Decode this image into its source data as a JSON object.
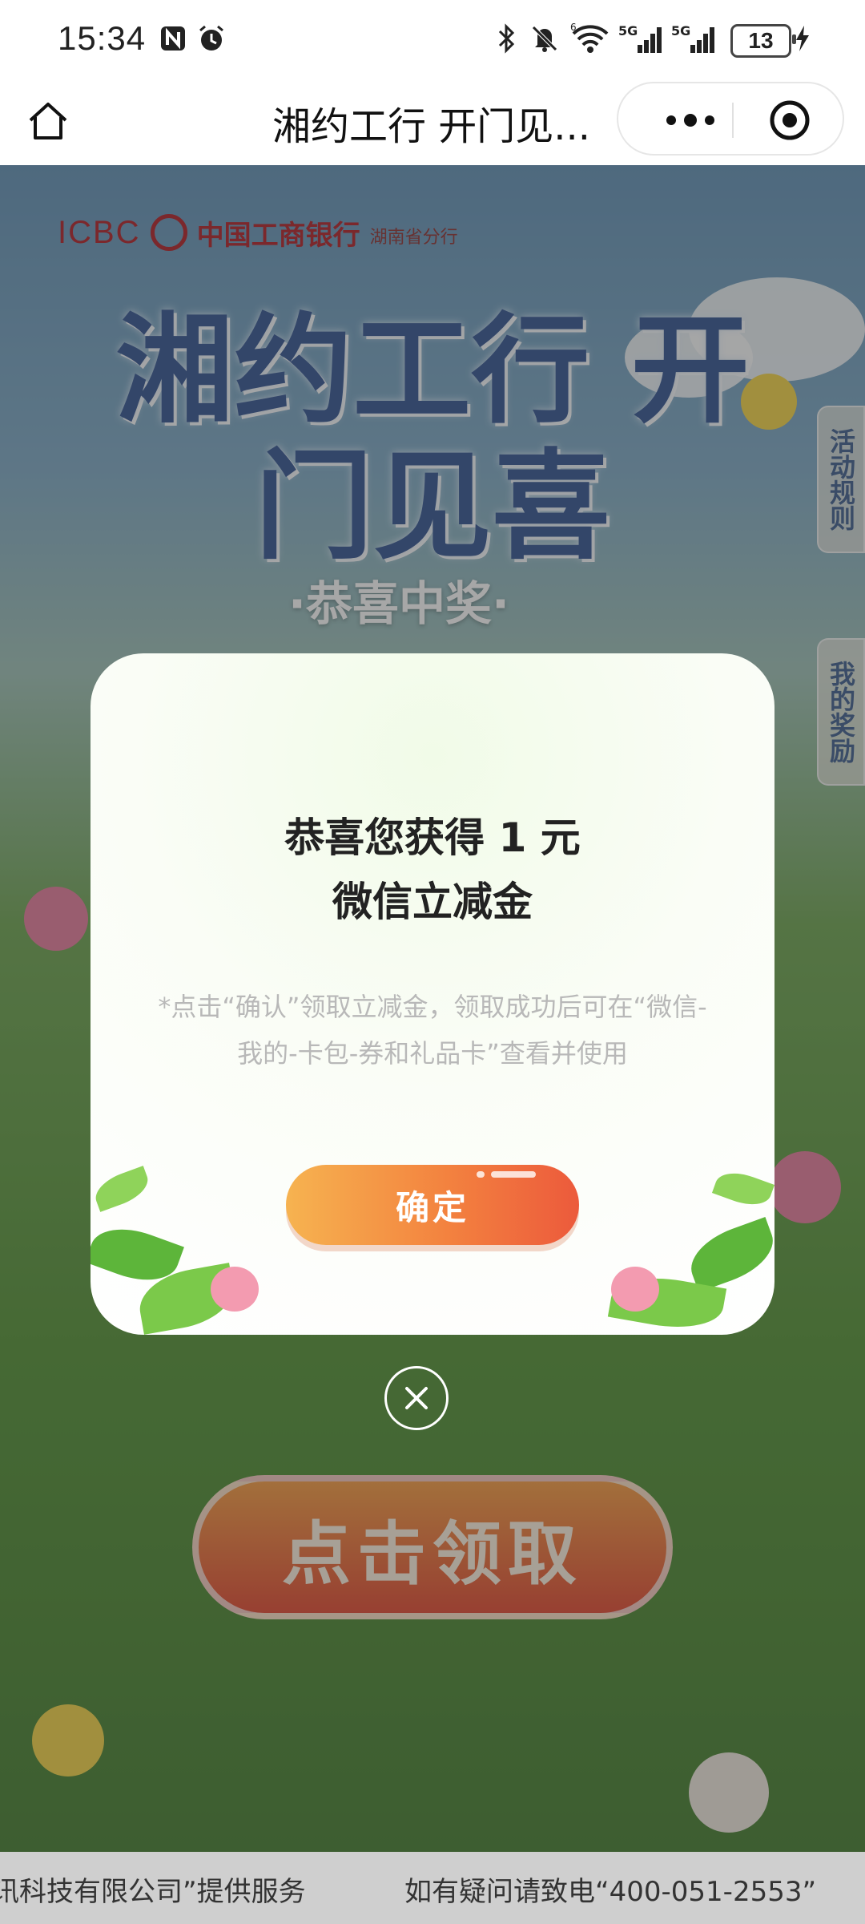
{
  "status_bar": {
    "time": "15:34",
    "battery": "13",
    "icons": [
      "nfc-icon",
      "alarm-icon",
      "bluetooth-icon",
      "mute-icon",
      "wifi-icon",
      "signal-5g-icon",
      "signal-5g-icon",
      "charging-icon"
    ]
  },
  "titlebar": {
    "title": "湘约工行 开门见..."
  },
  "page": {
    "logo_en": "ICBC",
    "logo_cn": "中国工商银行",
    "logo_branch": "湖南省分行",
    "hero_title": "湘约工行 开门见喜",
    "hero_sub": "·恭喜中奖·",
    "side_tabs": [
      "活动规则",
      "我的奖励"
    ],
    "claim_button": "点击领取"
  },
  "modal": {
    "title_line1": "恭喜您获得 1 元",
    "title_line2": "微信立减金",
    "description": "*点击“确认”领取立减金，领取成功后可在“微信-我的-卡包-券和礼品卡”查看并使用",
    "confirm_label": "确定"
  },
  "footer": {
    "left_text": "讯科技有限公司”提供服务",
    "right_text": "如有疑问请致电“400-051-2553”"
  },
  "colors": {
    "accent_red": "#b01820",
    "button_orange": "#f3823f",
    "title_blue": "#2d4f8f"
  }
}
